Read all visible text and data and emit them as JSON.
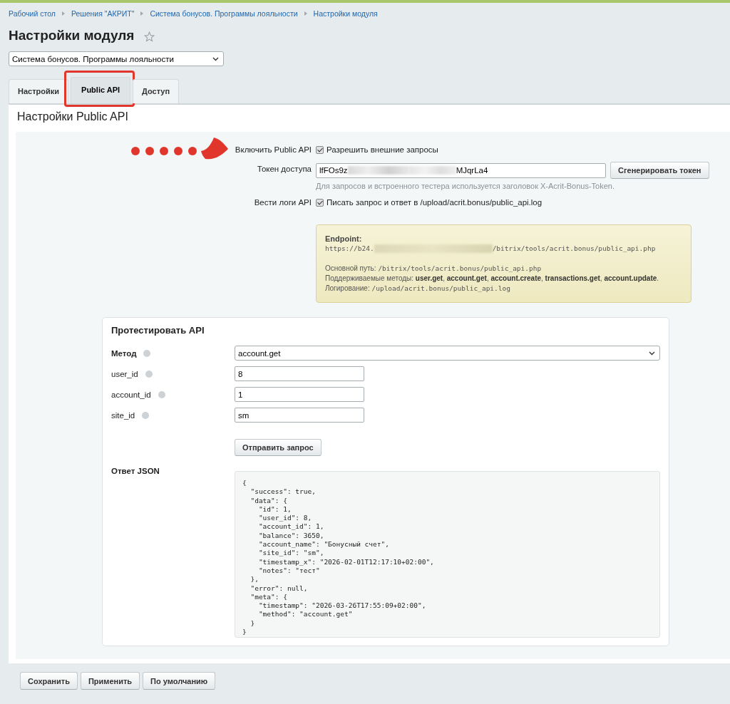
{
  "breadcrumbs": [
    "Рабочий стол",
    "Решения \"АКРИТ\"",
    "Система бонусов. Программы лояльности",
    "Настройки модуля"
  ],
  "title": "Настройки модуля",
  "favorite": false,
  "module_select": {
    "value": "Система бонусов. Программы лояльности"
  },
  "tabs": [
    {
      "label": "Настройки",
      "selected": false,
      "highlighted": false
    },
    {
      "label": "Public API",
      "selected": true,
      "highlighted": true
    },
    {
      "label": "Доступ",
      "selected": false,
      "highlighted": false
    }
  ],
  "section_title": "Настройки Public API",
  "enable_api": {
    "label": "Включить Public API",
    "checkbox_label": "Разрешить внешние запросы",
    "checked": true
  },
  "token": {
    "label": "Токен доступа",
    "value_start": "lfFOs9z",
    "value_end": "MJqrLa4",
    "button": "Сгенерировать токен",
    "hint": "Для запросов и встроенного тестера используется заголовок X-Acrit-Bonus-Token."
  },
  "logging": {
    "label": "Вести логи API",
    "checkbox_label": "Писать запрос и ответ в /upload/acrit.bonus/public_api.log",
    "checked": true
  },
  "info": {
    "endpoint_label": "Endpoint:",
    "endpoint_start": "https://b24.",
    "endpoint_end": "/bitrix/tools/acrit.bonus/public_api.php",
    "path_label": "Основной путь:",
    "path_value": "/bitrix/tools/acrit.bonus/public_api.php",
    "methods": "Поддерживаемые методы: **user.get**, **account.get**, **account.create**, **transactions.get**, **account.update**.",
    "log_label": "Логирование:",
    "log_value": "/upload/acrit.bonus/public_api.log"
  },
  "tester": {
    "title": "Протестировать API",
    "method": {
      "label": "Метод",
      "value": "account.get"
    },
    "fields": [
      {
        "label": "user_id",
        "value": "8"
      },
      {
        "label": "account_id",
        "value": "1"
      },
      {
        "label": "site_id",
        "value": "sm"
      }
    ],
    "send_button": "Отправить запрос",
    "response_label": "Ответ JSON",
    "response_lines": [
      "{",
      "  \"success\": true,",
      "  \"data\": {",
      "    \"id\": 1,",
      "    \"user_id\": 8,",
      "    \"account_id\": 1,",
      "    \"balance\": 3650,",
      "    \"account_name\": \"Бонусный счет\",",
      "    \"site_id\": \"sm\",",
      "    \"timestamp_x\": \"2026-02-01T12:17:10+02:00\",",
      "    \"notes\": \"тест\"",
      "  },",
      "  \"error\": null,",
      "  \"meta\": {",
      "    \"timestamp\": \"2026-03-26T17:55:09+02:00\",",
      "    \"method\": \"account.get\"",
      "  }",
      "}"
    ]
  },
  "footer_buttons": [
    "Сохранить",
    "Применить",
    "По умолчанию"
  ]
}
